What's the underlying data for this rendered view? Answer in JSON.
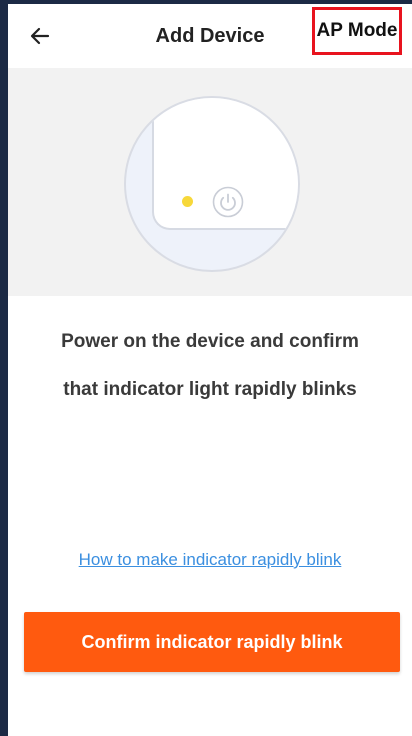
{
  "header": {
    "title": "Add Device",
    "mode_button": "AP Mode",
    "back_icon": "arrow-left-icon"
  },
  "illustration": {
    "indicator_color": "#f7d83a",
    "power_icon": "power-icon"
  },
  "instruction": {
    "line1": "Power on the device and confirm",
    "line2": "that indicator light rapidly blinks"
  },
  "help_link": "How to make indicator rapidly blink",
  "confirm_button": "Confirm indicator rapidly blink",
  "colors": {
    "accent": "#ff5a0f",
    "link": "#3b8fe0",
    "highlight_border": "#e8131e"
  }
}
